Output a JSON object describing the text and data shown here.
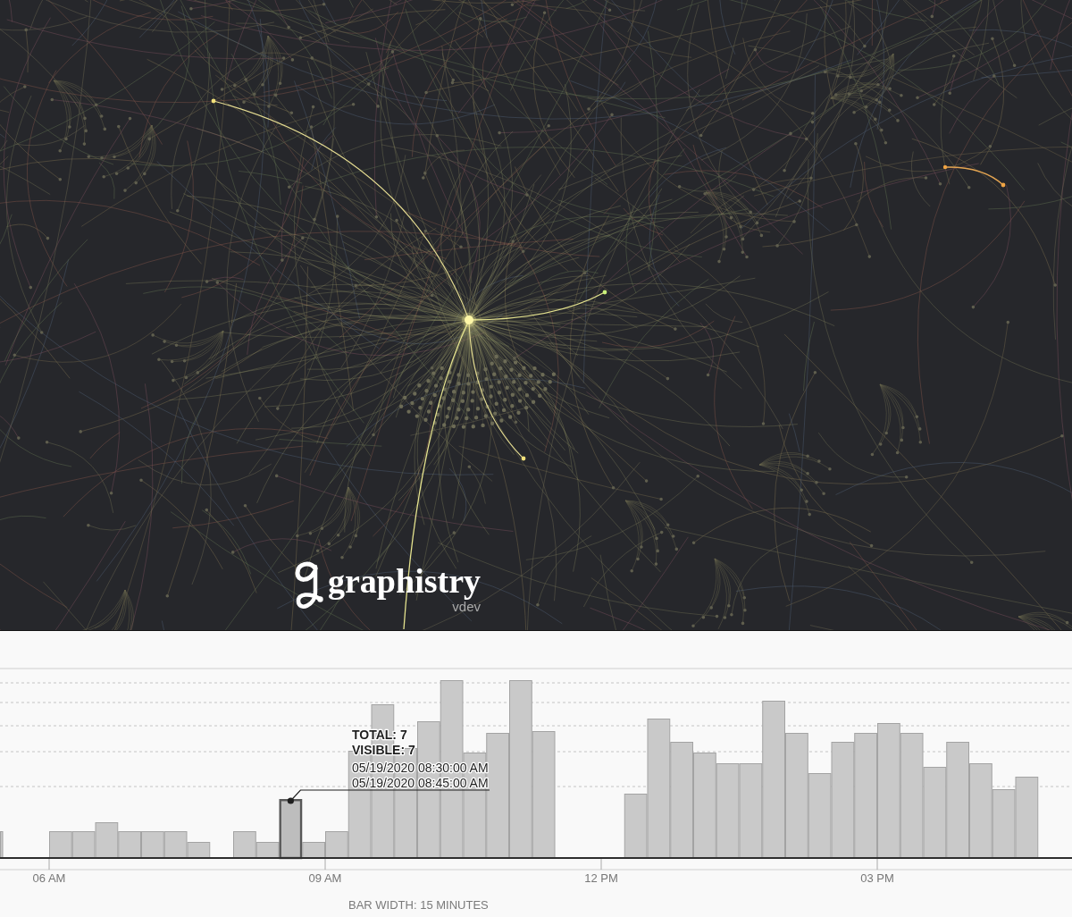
{
  "graph": {
    "logo": {
      "wordmark": "graphistry",
      "version": "vdev"
    }
  },
  "histogram": {
    "bars": [
      {
        "selected": false
      },
      {
        "selected": false
      },
      {
        "selected": false
      },
      {
        "selected": false
      },
      {
        "selected": false
      },
      {
        "selected": false
      },
      {
        "selected": false
      },
      {
        "selected": false
      },
      {
        "selected": false
      },
      {
        "selected": false
      },
      {
        "selected": true
      },
      {
        "selected": false
      },
      {
        "selected": false
      },
      {
        "selected": false
      },
      {
        "selected": false
      },
      {
        "selected": false
      },
      {
        "selected": false
      },
      {
        "selected": false
      },
      {
        "selected": false
      },
      {
        "selected": false
      },
      {
        "selected": false
      },
      {
        "selected": false
      },
      {
        "selected": false
      },
      {
        "selected": false
      },
      {
        "selected": false
      },
      {
        "selected": false
      },
      {
        "selected": false
      },
      {
        "selected": false
      },
      {
        "selected": false
      },
      {
        "selected": false
      },
      {
        "selected": false
      },
      {
        "selected": false
      },
      {
        "selected": false
      },
      {
        "selected": false
      },
      {
        "selected": false
      },
      {
        "selected": false
      },
      {
        "selected": false
      },
      {
        "selected": false
      },
      {
        "selected": false
      },
      {
        "selected": false
      }
    ],
    "tooltip": {
      "lines": [
        {
          "kind": "count",
          "text": "TOTAL: 7"
        },
        {
          "kind": "count",
          "text": "VISIBLE: 7"
        },
        {
          "kind": "time",
          "text": "05/19/2020 08:30:00 AM"
        },
        {
          "kind": "time",
          "text": "05/19/2020 08:45:00 AM"
        }
      ]
    },
    "x_axis": {
      "ticks": [
        "06 AM",
        "09 AM",
        "12 PM",
        "03 PM"
      ]
    },
    "footer": "BAR WIDTH: 15 MINUTES"
  }
}
